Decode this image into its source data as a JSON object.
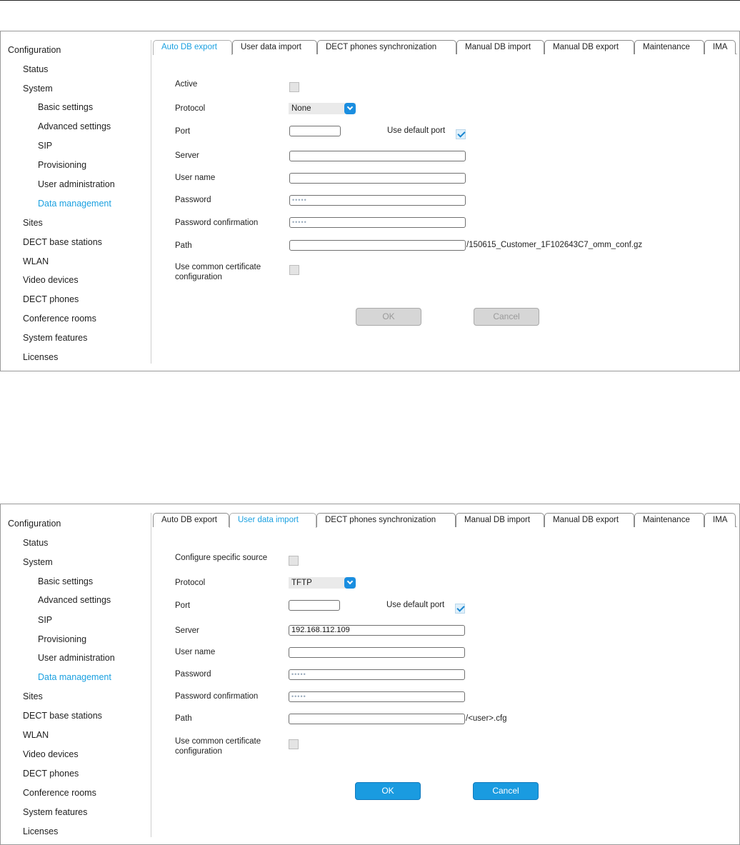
{
  "sidebar": {
    "items": [
      {
        "label": "Configuration"
      },
      {
        "label": "Status"
      },
      {
        "label": "System"
      },
      {
        "label": "Basic settings"
      },
      {
        "label": "Advanced settings"
      },
      {
        "label": "SIP"
      },
      {
        "label": "Provisioning"
      },
      {
        "label": "User administration"
      },
      {
        "label": "Data management"
      },
      {
        "label": "Sites"
      },
      {
        "label": "DECT base stations"
      },
      {
        "label": "WLAN"
      },
      {
        "label": "Video devices"
      },
      {
        "label": "DECT phones"
      },
      {
        "label": "Conference rooms"
      },
      {
        "label": "System features"
      },
      {
        "label": "Licenses"
      }
    ],
    "active_item": "Data management",
    "accent_color": "#1aa0e0"
  },
  "tabs": [
    "Auto DB export",
    "User data import",
    "DECT phones synchronization",
    "Manual DB import",
    "Manual DB export",
    "Maintenance",
    "IMA"
  ],
  "panel1": {
    "active_tab": "Auto DB export",
    "active_label": "Active",
    "active_checked": false,
    "protocol_label": "Protocol",
    "protocol_value": "None",
    "port_label": "Port",
    "port_value": "",
    "use_default_port_label": "Use default port",
    "use_default_port_checked": true,
    "server_label": "Server",
    "server_value": "",
    "username_label": "User name",
    "username_value": "",
    "password_label": "Password",
    "password_value": "•••••",
    "password_confirm_label": "Password confirmation",
    "password_confirm_value": "•••••",
    "path_label": "Path",
    "path_value": "",
    "path_suffix": "/150615_Customer_1F102643C7_omm_conf.gz",
    "cert_label_line1": "Use common certificate",
    "cert_label_line2": "configuration",
    "cert_checked": false,
    "ok_label": "OK",
    "cancel_label": "Cancel",
    "buttons_enabled": false
  },
  "panel2": {
    "active_tab": "User data import",
    "specific_source_label": "Configure specific source",
    "specific_source_checked": false,
    "protocol_label": "Protocol",
    "protocol_value": "TFTP",
    "port_label": "Port",
    "port_value": "",
    "use_default_port_label": "Use default port",
    "use_default_port_checked": true,
    "server_label": "Server",
    "server_value": "192.168.112.109",
    "username_label": "User name",
    "username_value": "",
    "password_label": "Password",
    "password_value": "•••••",
    "password_confirm_label": "Password confirmation",
    "password_confirm_value": "•••••",
    "path_label": "Path",
    "path_value": "",
    "path_suffix": "/<user>.cfg",
    "cert_label_line1": "Use common certificate",
    "cert_label_line2": "configuration",
    "cert_checked": false,
    "ok_label": "OK",
    "cancel_label": "Cancel",
    "buttons_enabled": true
  }
}
